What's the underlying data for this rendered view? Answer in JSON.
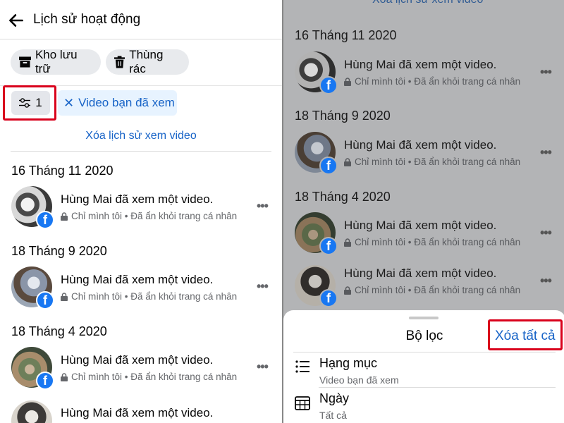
{
  "left": {
    "header_title": "Lịch sử hoạt động",
    "chips": {
      "archive": "Kho lưu trữ",
      "trash": "Thùng rác"
    },
    "filter_count": "1",
    "video_filter": "Video bạn đã xem",
    "clear_link": "Xóa lịch sử xem video",
    "groups": [
      {
        "date": "16 Tháng 11 2020",
        "title": "Hùng Mai đã xem một video.",
        "privacy": "Chỉ mình tôi",
        "status": "Đã ẩn khỏi trang cá nhân"
      },
      {
        "date": "18 Tháng 9 2020",
        "title": "Hùng Mai đã xem một video.",
        "privacy": "Chỉ mình tôi",
        "status": "Đã ẩn khỏi trang cá nhân"
      },
      {
        "date": "18 Tháng 4 2020",
        "title": "Hùng Mai đã xem một video.",
        "privacy": "Chỉ mình tôi",
        "status": "Đã ẩn khỏi trang cá nhân"
      },
      {
        "date": "",
        "title": "Hùng Mai đã xem một video.",
        "privacy": "",
        "status": ""
      }
    ]
  },
  "right": {
    "top_link": "Xóa lịch sử xem video",
    "groups": [
      {
        "date": "16 Tháng 11 2020",
        "title": "Hùng Mai đã xem một video.",
        "privacy": "Chỉ mình tôi",
        "status": "Đã ẩn khỏi trang cá nhân"
      },
      {
        "date": "18 Tháng 9 2020",
        "title": "Hùng Mai đã xem một video.",
        "privacy": "Chỉ mình tôi",
        "status": "Đã ẩn khỏi trang cá nhân"
      },
      {
        "date": "18 Tháng 4 2020",
        "title": "Hùng Mai đã xem một video.",
        "privacy": "Chỉ mình tôi",
        "status": "Đã ẩn khỏi trang cá nhân"
      },
      {
        "date": "",
        "title": "Hùng Mai đã xem một video.",
        "privacy": "Chỉ mình tôi",
        "status": "Đã ẩn khỏi trang cá nhân"
      }
    ],
    "sheet": {
      "title": "Bộ lọc",
      "clear_all": "Xóa tất cả",
      "options": [
        {
          "label": "Hạng mục",
          "sub": "Video bạn đã xem",
          "icon": "list-icon"
        },
        {
          "label": "Ngày",
          "sub": "Tất cả",
          "icon": "calendar-icon"
        }
      ]
    }
  },
  "colors": {
    "link_blue": "#1763c7",
    "facebook_blue": "#1877f2",
    "highlight_red": "#d9001b",
    "chip_gray": "#e8eaed",
    "overlay_gray": "#b3b4b6"
  }
}
